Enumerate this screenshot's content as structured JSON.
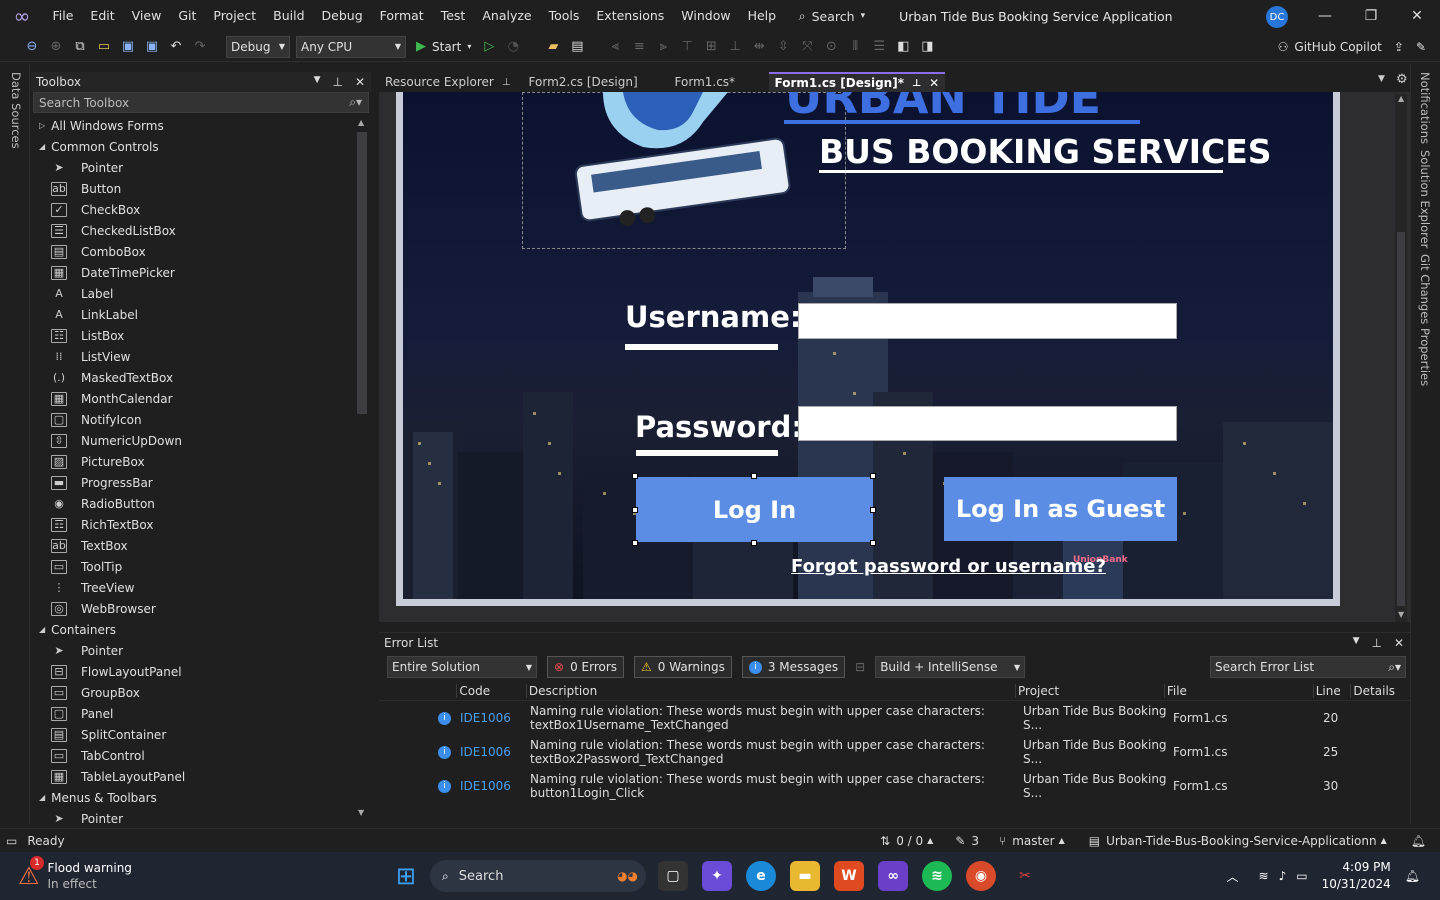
{
  "menubar": {
    "items": [
      "File",
      "Edit",
      "View",
      "Git",
      "Project",
      "Build",
      "Debug",
      "Format",
      "Test",
      "Analyze",
      "Tools",
      "Extensions",
      "Window",
      "Help"
    ],
    "search_label": "Search",
    "window_title": "Urban Tide Bus Booking Service Application",
    "avatar_initials": "DC"
  },
  "toolbar": {
    "config": "Debug",
    "platform": "Any CPU",
    "start_label": "Start",
    "copilot_label": "GitHub Copilot"
  },
  "left_strip": {
    "label": "Data Sources"
  },
  "right_strip": {
    "labels": [
      "Notifications",
      "Solution Explorer",
      "Git Changes",
      "Properties"
    ]
  },
  "toolbox": {
    "title": "Toolbox",
    "search_placeholder": "Search Toolbox",
    "rows": [
      {
        "type": "group",
        "label": "All Windows Forms",
        "expanded": false
      },
      {
        "type": "group",
        "label": "Common Controls",
        "expanded": true
      },
      {
        "type": "tool",
        "label": "Pointer",
        "icon": "arrow-icon"
      },
      {
        "type": "tool",
        "label": "Button",
        "icon": "button-icon"
      },
      {
        "type": "tool",
        "label": "CheckBox",
        "icon": "checkbox-icon"
      },
      {
        "type": "tool",
        "label": "CheckedListBox",
        "icon": "checked-list-icon"
      },
      {
        "type": "tool",
        "label": "ComboBox",
        "icon": "combobox-icon"
      },
      {
        "type": "tool",
        "label": "DateTimePicker",
        "icon": "datetime-icon"
      },
      {
        "type": "tool",
        "label": "Label",
        "icon": "label-icon"
      },
      {
        "type": "tool",
        "label": "LinkLabel",
        "icon": "linklabel-icon"
      },
      {
        "type": "tool",
        "label": "ListBox",
        "icon": "listbox-icon"
      },
      {
        "type": "tool",
        "label": "ListView",
        "icon": "listview-icon"
      },
      {
        "type": "tool",
        "label": "MaskedTextBox",
        "icon": "masked-icon"
      },
      {
        "type": "tool",
        "label": "MonthCalendar",
        "icon": "calendar-icon"
      },
      {
        "type": "tool",
        "label": "NotifyIcon",
        "icon": "notify-icon"
      },
      {
        "type": "tool",
        "label": "NumericUpDown",
        "icon": "numeric-icon"
      },
      {
        "type": "tool",
        "label": "PictureBox",
        "icon": "picture-icon"
      },
      {
        "type": "tool",
        "label": "ProgressBar",
        "icon": "progress-icon"
      },
      {
        "type": "tool",
        "label": "RadioButton",
        "icon": "radio-icon"
      },
      {
        "type": "tool",
        "label": "RichTextBox",
        "icon": "richtext-icon"
      },
      {
        "type": "tool",
        "label": "TextBox",
        "icon": "textbox-icon"
      },
      {
        "type": "tool",
        "label": "ToolTip",
        "icon": "tooltip-icon"
      },
      {
        "type": "tool",
        "label": "TreeView",
        "icon": "treeview-icon"
      },
      {
        "type": "tool",
        "label": "WebBrowser",
        "icon": "webbrowser-icon"
      },
      {
        "type": "group",
        "label": "Containers",
        "expanded": true
      },
      {
        "type": "tool",
        "label": "Pointer",
        "icon": "arrow-icon"
      },
      {
        "type": "tool",
        "label": "FlowLayoutPanel",
        "icon": "flow-icon"
      },
      {
        "type": "tool",
        "label": "GroupBox",
        "icon": "groupbox-icon"
      },
      {
        "type": "tool",
        "label": "Panel",
        "icon": "panel-icon"
      },
      {
        "type": "tool",
        "label": "SplitContainer",
        "icon": "split-icon"
      },
      {
        "type": "tool",
        "label": "TabControl",
        "icon": "tabcontrol-icon"
      },
      {
        "type": "tool",
        "label": "TableLayoutPanel",
        "icon": "table-icon"
      },
      {
        "type": "group",
        "label": "Menus & Toolbars",
        "expanded": true
      },
      {
        "type": "tool",
        "label": "Pointer",
        "icon": "arrow-icon"
      }
    ]
  },
  "tabs": [
    {
      "label": "Resource Explorer",
      "active": false,
      "pinned": true
    },
    {
      "label": "Form2.cs [Design]",
      "active": false
    },
    {
      "label": "Form1.cs*",
      "active": false
    },
    {
      "label": "Form1.cs [Design]*",
      "active": true
    }
  ],
  "form": {
    "title_top": "URBAN TIDE",
    "title_sub": "BUS BOOKING SERVICES",
    "username_label": "Username:",
    "password_label": "Password:",
    "login_button": "Log In",
    "guest_button": "Log In as Guest",
    "forgot_link": "Forgot password or username?"
  },
  "error_list": {
    "title": "Error List",
    "scope": "Entire Solution",
    "errors": "0 Errors",
    "warnings": "0 Warnings",
    "messages": "3 Messages",
    "build_filter": "Build + IntelliSense",
    "search_placeholder": "Search Error List",
    "columns": [
      "Code",
      "Description",
      "Project",
      "File",
      "Line",
      "Details"
    ],
    "rows": [
      {
        "code": "IDE1006",
        "desc1": "Naming rule violation: These words must begin with upper case characters:",
        "desc2": "textBox1Username_TextChanged",
        "project": "Urban Tide Bus Booking S...",
        "file": "Form1.cs",
        "line": "20"
      },
      {
        "code": "IDE1006",
        "desc1": "Naming rule violation: These words must begin with upper case characters:",
        "desc2": "textBox2Password_TextChanged",
        "project": "Urban Tide Bus Booking S...",
        "file": "Form1.cs",
        "line": "25"
      },
      {
        "code": "IDE1006",
        "desc1": "Naming rule violation: These words must begin with upper case characters:",
        "desc2": "button1Login_Click",
        "project": "Urban Tide Bus Booking S...",
        "file": "Form1.cs",
        "line": "30"
      }
    ]
  },
  "statusbar": {
    "ready": "Ready",
    "sync": "0 / 0",
    "edits": "3",
    "branch": "master",
    "repo": "Urban-Tide-Bus-Booking-Service-Applicationn"
  },
  "taskbar": {
    "weather_title": "Flood warning",
    "weather_sub": "In effect",
    "weather_badge": "1",
    "search": "Search",
    "time": "4:09 PM",
    "date": "10/31/2024"
  }
}
